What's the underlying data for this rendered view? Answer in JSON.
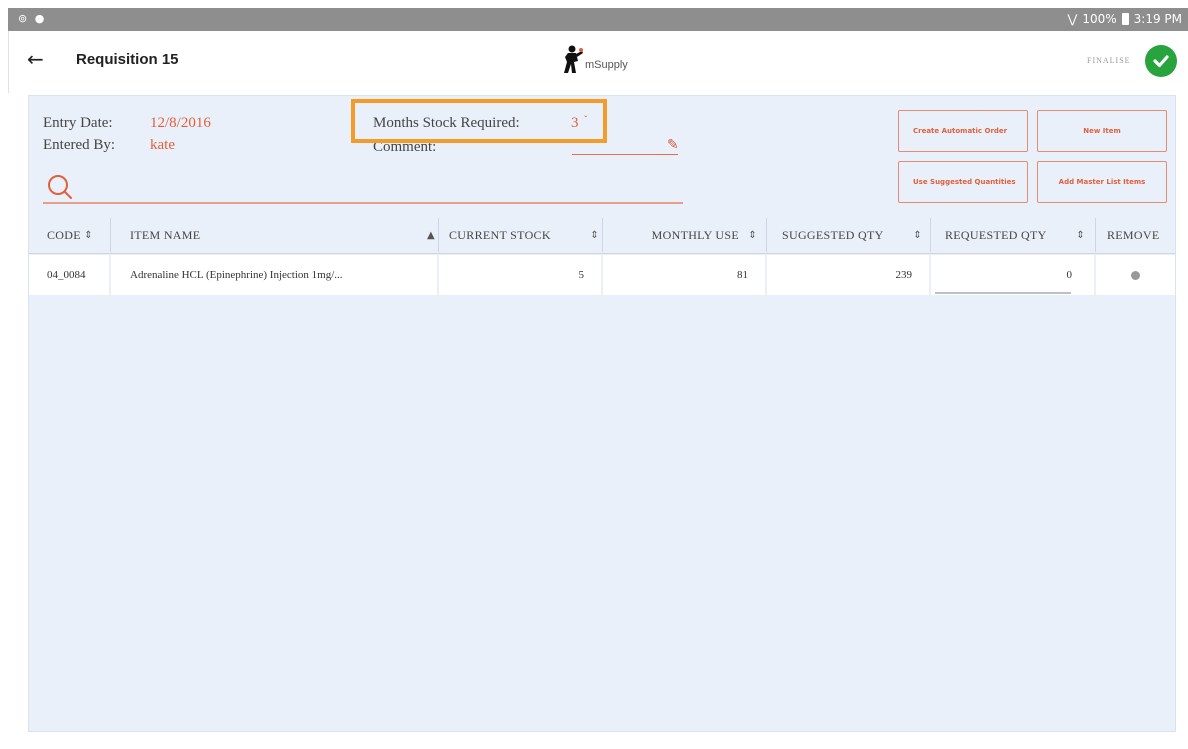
{
  "status_bar": {
    "left_icons": "⊚ ●",
    "battery": "100%",
    "time": "3:19 PM"
  },
  "header": {
    "back_icon": "arrow-left-icon",
    "title": "Requisition 15",
    "logo_text": "mSupply",
    "finalise_label": "FINALISE",
    "finalise_icon": "check-circle-icon"
  },
  "details": {
    "entry_date_label": "Entry Date:",
    "entry_date_value": "12/8/2016",
    "entered_by_label": "Entered By:",
    "entered_by_value": "kate",
    "months_label": "Months Stock Required:",
    "months_value": "3",
    "comment_label": "Comment:",
    "comment_value": ""
  },
  "buttons": {
    "create_automatic_order": "Create Automatic Order",
    "new_item": "New Item",
    "use_suggested_quantities": "Use Suggested Quantities",
    "add_master_list_items": "Add Master List Items"
  },
  "table": {
    "columns": [
      "CODE",
      "ITEM NAME",
      "CURRENT STOCK",
      "MONTHLY USE",
      "SUGGESTED QTY",
      "REQUESTED QTY",
      "REMOVE"
    ],
    "rows": [
      {
        "code": "04_0084",
        "item_name": "Adrenaline HCL (Epinephrine) Injection 1mg/...",
        "current_stock": "5",
        "monthly_use": "81",
        "suggested_qty": "239",
        "requested_qty": "0"
      }
    ]
  },
  "colors": {
    "accent": "#e0603c",
    "highlight": "#f39c2a",
    "finalise_green": "#27a43d",
    "panel_bg": "#eaf0fa"
  }
}
